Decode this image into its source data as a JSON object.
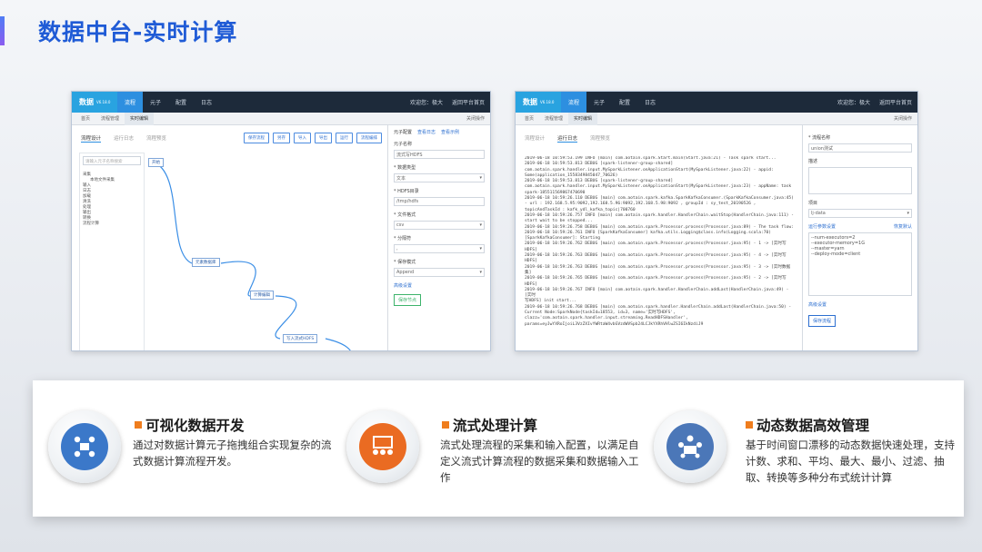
{
  "page": {
    "title": "数据中台-实时计算"
  },
  "app": {
    "logo": "数据",
    "logo_version": "V6.18.0",
    "nav": [
      "流程",
      "元子",
      "配置",
      "日志"
    ],
    "welcome": "欢迎您：极大",
    "return_link": "返回平台首页"
  },
  "left_shot": {
    "tabs": [
      "首页",
      "流程管理",
      "实时编辑"
    ],
    "tab_right": "关闭操作",
    "subtabs": [
      "流程设计",
      "运行日志",
      "流程预览"
    ],
    "toolbar": [
      "保存流程",
      "另存",
      "导入",
      "导出",
      "运行",
      "流程编排"
    ],
    "tree_search": "请输入元子名称搜索",
    "tree_items": [
      "采集",
      "本地文件采集",
      "输入",
      "日志",
      "加载",
      "清洗",
      "处理",
      "输出",
      "转换",
      "流程计算"
    ],
    "nodes": [
      "开始",
      "元素数据库",
      "计算编辑",
      "写入流式HDFS",
      "结束"
    ],
    "panel_tabs": [
      "元子配置",
      "查看日志",
      "查看示例"
    ],
    "panel_fields": [
      {
        "label": "元子名称",
        "value": "流式写HDFS"
      },
      {
        "label": "* 数据类型",
        "value": "文本"
      },
      {
        "label": "* HDFS目录",
        "value": "/tmp/hdfs"
      },
      {
        "label": "* 文件格式",
        "value": "csv"
      },
      {
        "label": "* 分隔符",
        "value": ","
      },
      {
        "label": "* 保存模式",
        "value": "Append"
      }
    ],
    "advanced_link": "高级设置",
    "save_button": "保存节点"
  },
  "right_shot": {
    "tabs": [
      "首页",
      "流程管理",
      "实时编辑"
    ],
    "tab_right": "关闭操作",
    "subtabs": [
      "流程设计",
      "运行日志",
      "流程预览"
    ],
    "log_lines": [
      "2019-06-18 10:59:53.199 INFO [main] com.aotain.spark.Start.main(Start.java:21) - Task spark start...",
      "2019-06-18 10:59:53.813 DEBUG [spark-listener-group-shared]",
      "com.aotain.spark.handler.input.MySparkListener.onApplicationStart(MySparkListener.java:22) - appid:",
      "Some(application_1558349845047_70626)",
      "2019-06-18 10:59:53.813 DEBUG [spark-listener-group-shared]",
      "com.aotain.spark.handler.input.MySparkListener.onApplicationStart(MySparkListener.java:23) - appName: task",
      "spark-185511569867470690",
      "2019-06-18 10:59:26.110 DEBUG [main] com.aotain.spark.kafka.SparkKafkaConsumer.(SparkKafkaConsumer.java:45)",
      "- url : 192.168.5.95:9092,192.168.5.96:9092,192.168.5.98:9092 , groupId : sy_test_20190526 ,",
      "topicAndTaskId : kafk_ydl_kafka_topic|700760",
      "2019-06-18 10:59:26.757 INFO [main] com.aotain.spark.handler.HandlerChain.waitStop(HandlerChain.java:111) -",
      "start wait to be stopped...",
      "2019-06-18 10:59:26.758 DEBUG [main] com.aotain.spark.Processor.process(Processor.java:89) - The task flow:",
      "2019-06-18 10:59:26.761 INFO [SparkKafkaConsumer] kafka.utils.Logging$class.info(Logging.scala:70)",
      "[SparkKafkaConsumer]: Starting",
      "2019-06-18 10:59:26.762 DEBUG [main] com.aotain.spark.Processor.process(Processor.java:95) - 1 -> [实时写HDFS]",
      "2019-06-18 10:59:26.763 DEBUG [main] com.aotain.spark.Processor.process(Processor.java:95) - 4 -> [实时写HDFS]",
      "2019-06-18 10:59:26.763 DEBUG [main] com.aotain.spark.Processor.process(Processor.java:95) - 3 -> [实时数据集]",
      "2019-06-18 10:59:26.765 DEBUG [main] com.aotain.spark.Processor.process(Processor.java:95) - 2 -> [实时写HDFS]",
      "2019-06-18 10:59:26.767 INFO [main] com.aotain.spark.handler.HandlerChain.addLast(HandlerChain.java:49) - [实时",
      "写HDFS] init start...",
      "2019-06-18 10:59:26.768 DEBUG [main] com.aotain.spark.handler.HandlerChain.addLast(HandlerChain.java:50) -",
      "Current Node:SparkNode{taskId=18553, id=3, name='实时写HDFS',",
      "clazz='com.aotain.spark.handler.input.streaming.ReadHDFSHandler',",
      "params=eyJwYXRoIjoiL3VzZXIvYWRtaW4vbGVzdWVSpb24LCJkYXRhVHlwZSI6IkNzdiJ9"
    ],
    "panel_fields": [
      {
        "label": "* 流程名称",
        "value": "union测试"
      },
      {
        "label": "描述",
        "value": ""
      },
      {
        "label": "项目",
        "value": "lj-data"
      }
    ],
    "params_label": "运行参数设置",
    "params_reset": "恢复默认",
    "params_text": [
      "--num-executors=2",
      "--executor-memory=1G",
      "--master=yarn",
      "--deploy-mode=client"
    ],
    "advanced_link": "高级设置",
    "save_button": "保存流程"
  },
  "features": [
    {
      "title": "可视化数据开发",
      "desc": "通过对数据计算元子拖拽组合实现复杂的流式数据计算流程开发。",
      "icon": "meeting-icon"
    },
    {
      "title": "流式处理计算",
      "desc": "流式处理流程的采集和输入配置，以满足自定义流式计算流程的数据采集和数据输入工作",
      "icon": "presentation-icon"
    },
    {
      "title": "动态数据高效管理",
      "desc": "基于时间窗口漂移的动态数据快速处理，支持计数、求和、平均、最大、最小、过滤、抽取、转换等多种分布式统计计算",
      "icon": "team-icon"
    }
  ],
  "colors": {
    "title": "#1f5bd6",
    "accent": "#ef7d1d",
    "nav": "#1d2a3a",
    "logo": "#29a3e0"
  }
}
